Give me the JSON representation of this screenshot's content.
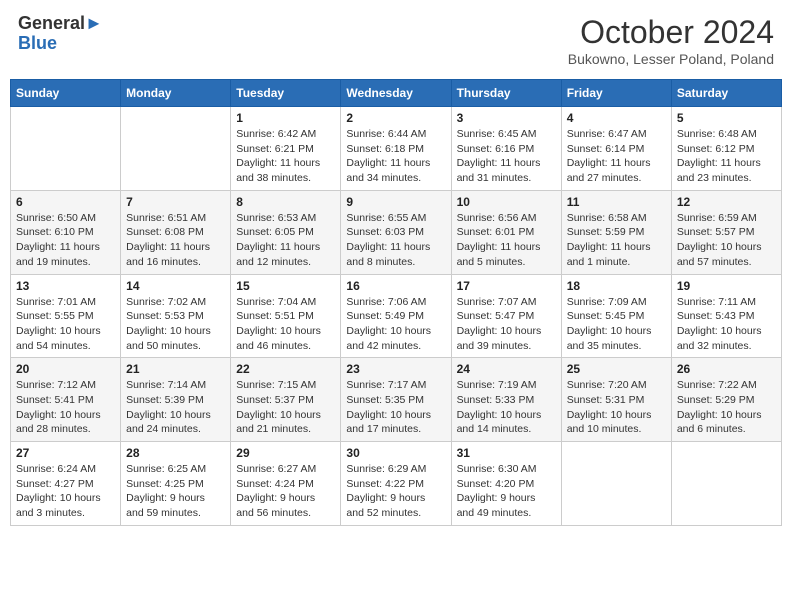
{
  "header": {
    "logo_line1": "General",
    "logo_line2": "Blue",
    "month_title": "October 2024",
    "subtitle": "Bukowno, Lesser Poland, Poland"
  },
  "weekdays": [
    "Sunday",
    "Monday",
    "Tuesday",
    "Wednesday",
    "Thursday",
    "Friday",
    "Saturday"
  ],
  "weeks": [
    [
      {
        "day": "",
        "info": ""
      },
      {
        "day": "",
        "info": ""
      },
      {
        "day": "1",
        "info": "Sunrise: 6:42 AM\nSunset: 6:21 PM\nDaylight: 11 hours and 38 minutes."
      },
      {
        "day": "2",
        "info": "Sunrise: 6:44 AM\nSunset: 6:18 PM\nDaylight: 11 hours and 34 minutes."
      },
      {
        "day": "3",
        "info": "Sunrise: 6:45 AM\nSunset: 6:16 PM\nDaylight: 11 hours and 31 minutes."
      },
      {
        "day": "4",
        "info": "Sunrise: 6:47 AM\nSunset: 6:14 PM\nDaylight: 11 hours and 27 minutes."
      },
      {
        "day": "5",
        "info": "Sunrise: 6:48 AM\nSunset: 6:12 PM\nDaylight: 11 hours and 23 minutes."
      }
    ],
    [
      {
        "day": "6",
        "info": "Sunrise: 6:50 AM\nSunset: 6:10 PM\nDaylight: 11 hours and 19 minutes."
      },
      {
        "day": "7",
        "info": "Sunrise: 6:51 AM\nSunset: 6:08 PM\nDaylight: 11 hours and 16 minutes."
      },
      {
        "day": "8",
        "info": "Sunrise: 6:53 AM\nSunset: 6:05 PM\nDaylight: 11 hours and 12 minutes."
      },
      {
        "day": "9",
        "info": "Sunrise: 6:55 AM\nSunset: 6:03 PM\nDaylight: 11 hours and 8 minutes."
      },
      {
        "day": "10",
        "info": "Sunrise: 6:56 AM\nSunset: 6:01 PM\nDaylight: 11 hours and 5 minutes."
      },
      {
        "day": "11",
        "info": "Sunrise: 6:58 AM\nSunset: 5:59 PM\nDaylight: 11 hours and 1 minute."
      },
      {
        "day": "12",
        "info": "Sunrise: 6:59 AM\nSunset: 5:57 PM\nDaylight: 10 hours and 57 minutes."
      }
    ],
    [
      {
        "day": "13",
        "info": "Sunrise: 7:01 AM\nSunset: 5:55 PM\nDaylight: 10 hours and 54 minutes."
      },
      {
        "day": "14",
        "info": "Sunrise: 7:02 AM\nSunset: 5:53 PM\nDaylight: 10 hours and 50 minutes."
      },
      {
        "day": "15",
        "info": "Sunrise: 7:04 AM\nSunset: 5:51 PM\nDaylight: 10 hours and 46 minutes."
      },
      {
        "day": "16",
        "info": "Sunrise: 7:06 AM\nSunset: 5:49 PM\nDaylight: 10 hours and 42 minutes."
      },
      {
        "day": "17",
        "info": "Sunrise: 7:07 AM\nSunset: 5:47 PM\nDaylight: 10 hours and 39 minutes."
      },
      {
        "day": "18",
        "info": "Sunrise: 7:09 AM\nSunset: 5:45 PM\nDaylight: 10 hours and 35 minutes."
      },
      {
        "day": "19",
        "info": "Sunrise: 7:11 AM\nSunset: 5:43 PM\nDaylight: 10 hours and 32 minutes."
      }
    ],
    [
      {
        "day": "20",
        "info": "Sunrise: 7:12 AM\nSunset: 5:41 PM\nDaylight: 10 hours and 28 minutes."
      },
      {
        "day": "21",
        "info": "Sunrise: 7:14 AM\nSunset: 5:39 PM\nDaylight: 10 hours and 24 minutes."
      },
      {
        "day": "22",
        "info": "Sunrise: 7:15 AM\nSunset: 5:37 PM\nDaylight: 10 hours and 21 minutes."
      },
      {
        "day": "23",
        "info": "Sunrise: 7:17 AM\nSunset: 5:35 PM\nDaylight: 10 hours and 17 minutes."
      },
      {
        "day": "24",
        "info": "Sunrise: 7:19 AM\nSunset: 5:33 PM\nDaylight: 10 hours and 14 minutes."
      },
      {
        "day": "25",
        "info": "Sunrise: 7:20 AM\nSunset: 5:31 PM\nDaylight: 10 hours and 10 minutes."
      },
      {
        "day": "26",
        "info": "Sunrise: 7:22 AM\nSunset: 5:29 PM\nDaylight: 10 hours and 6 minutes."
      }
    ],
    [
      {
        "day": "27",
        "info": "Sunrise: 6:24 AM\nSunset: 4:27 PM\nDaylight: 10 hours and 3 minutes."
      },
      {
        "day": "28",
        "info": "Sunrise: 6:25 AM\nSunset: 4:25 PM\nDaylight: 9 hours and 59 minutes."
      },
      {
        "day": "29",
        "info": "Sunrise: 6:27 AM\nSunset: 4:24 PM\nDaylight: 9 hours and 56 minutes."
      },
      {
        "day": "30",
        "info": "Sunrise: 6:29 AM\nSunset: 4:22 PM\nDaylight: 9 hours and 52 minutes."
      },
      {
        "day": "31",
        "info": "Sunrise: 6:30 AM\nSunset: 4:20 PM\nDaylight: 9 hours and 49 minutes."
      },
      {
        "day": "",
        "info": ""
      },
      {
        "day": "",
        "info": ""
      }
    ]
  ]
}
